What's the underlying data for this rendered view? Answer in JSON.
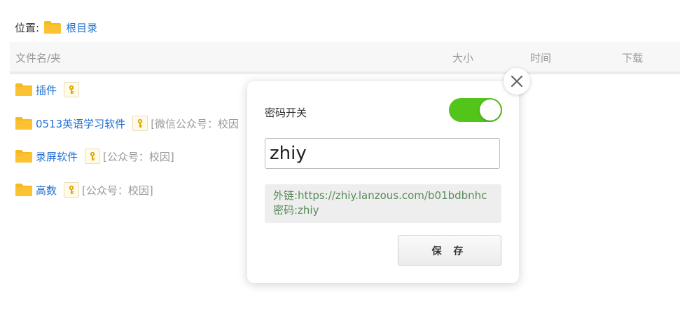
{
  "breadcrumb": {
    "label": "位置:",
    "root": "根目录"
  },
  "table_header": {
    "name": "文件名/夹",
    "size": "大小",
    "time": "时间",
    "download": "下载"
  },
  "files": [
    {
      "name": "插件",
      "note": ""
    },
    {
      "name": "0513英语学习软件",
      "note": "[微信公众号：校因"
    },
    {
      "name": "录屏软件",
      "note": "[公众号：校因]"
    },
    {
      "name": "高数",
      "note": "[公众号：校因]"
    }
  ],
  "popup": {
    "toggle_label": "密码开关",
    "toggle_on": true,
    "password_value": "zhiy",
    "link_line": "外链:https://zhiy.lanzous.com/b01bdbnhc",
    "password_line": "密码:zhiy",
    "save_label": "保 存"
  },
  "colors": {
    "folder": "#f9b81b",
    "link": "#1f6fd1",
    "toggle": "#52c41a",
    "info_text": "#5a8a5a"
  },
  "icons": {
    "folder": "folder-icon",
    "key": "key-icon",
    "close": "close-icon"
  }
}
